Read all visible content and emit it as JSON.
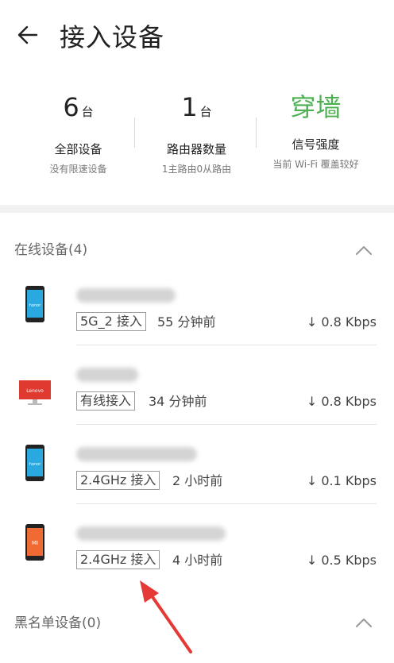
{
  "header": {
    "title": "接入设备"
  },
  "stats": [
    {
      "num": "6",
      "unit": "台",
      "label": "全部设备",
      "sub": "没有限速设备",
      "color": "#222222"
    },
    {
      "num": "1",
      "unit": "台",
      "label": "路由器数量",
      "sub": "1主路由0从路由",
      "color": "#222222"
    },
    {
      "num": "穿墙",
      "unit": "",
      "label": "信号强度",
      "sub": "当前 Wi-Fi 覆盖较好",
      "color": "#4caf50"
    }
  ],
  "online": {
    "title": "在线设备(4)",
    "devices": [
      {
        "icon": "phone-honor-icon",
        "badge": "5G_2 接入",
        "time": "55 分钟前",
        "speed": "↓ 0.8 Kbps"
      },
      {
        "icon": "monitor-lenovo-icon",
        "badge": "有线接入",
        "time": "34 分钟前",
        "speed": "↓ 0.8 Kbps"
      },
      {
        "icon": "phone-honor-icon",
        "badge": "2.4GHz 接入",
        "time": "2 小时前",
        "speed": "↓ 0.1 Kbps"
      },
      {
        "icon": "phone-mi-icon",
        "badge": "2.4GHz 接入",
        "time": "4 小时前",
        "speed": "↓ 0.5 Kbps"
      }
    ]
  },
  "blacklist": {
    "title": "黑名单设备(0)"
  },
  "icons": {
    "honor_text": "honor",
    "lenovo_text": "Lenovo",
    "mi_text": "MI"
  },
  "colors": {
    "accent_green": "#4caf50",
    "arrow_red": "#e53935"
  }
}
